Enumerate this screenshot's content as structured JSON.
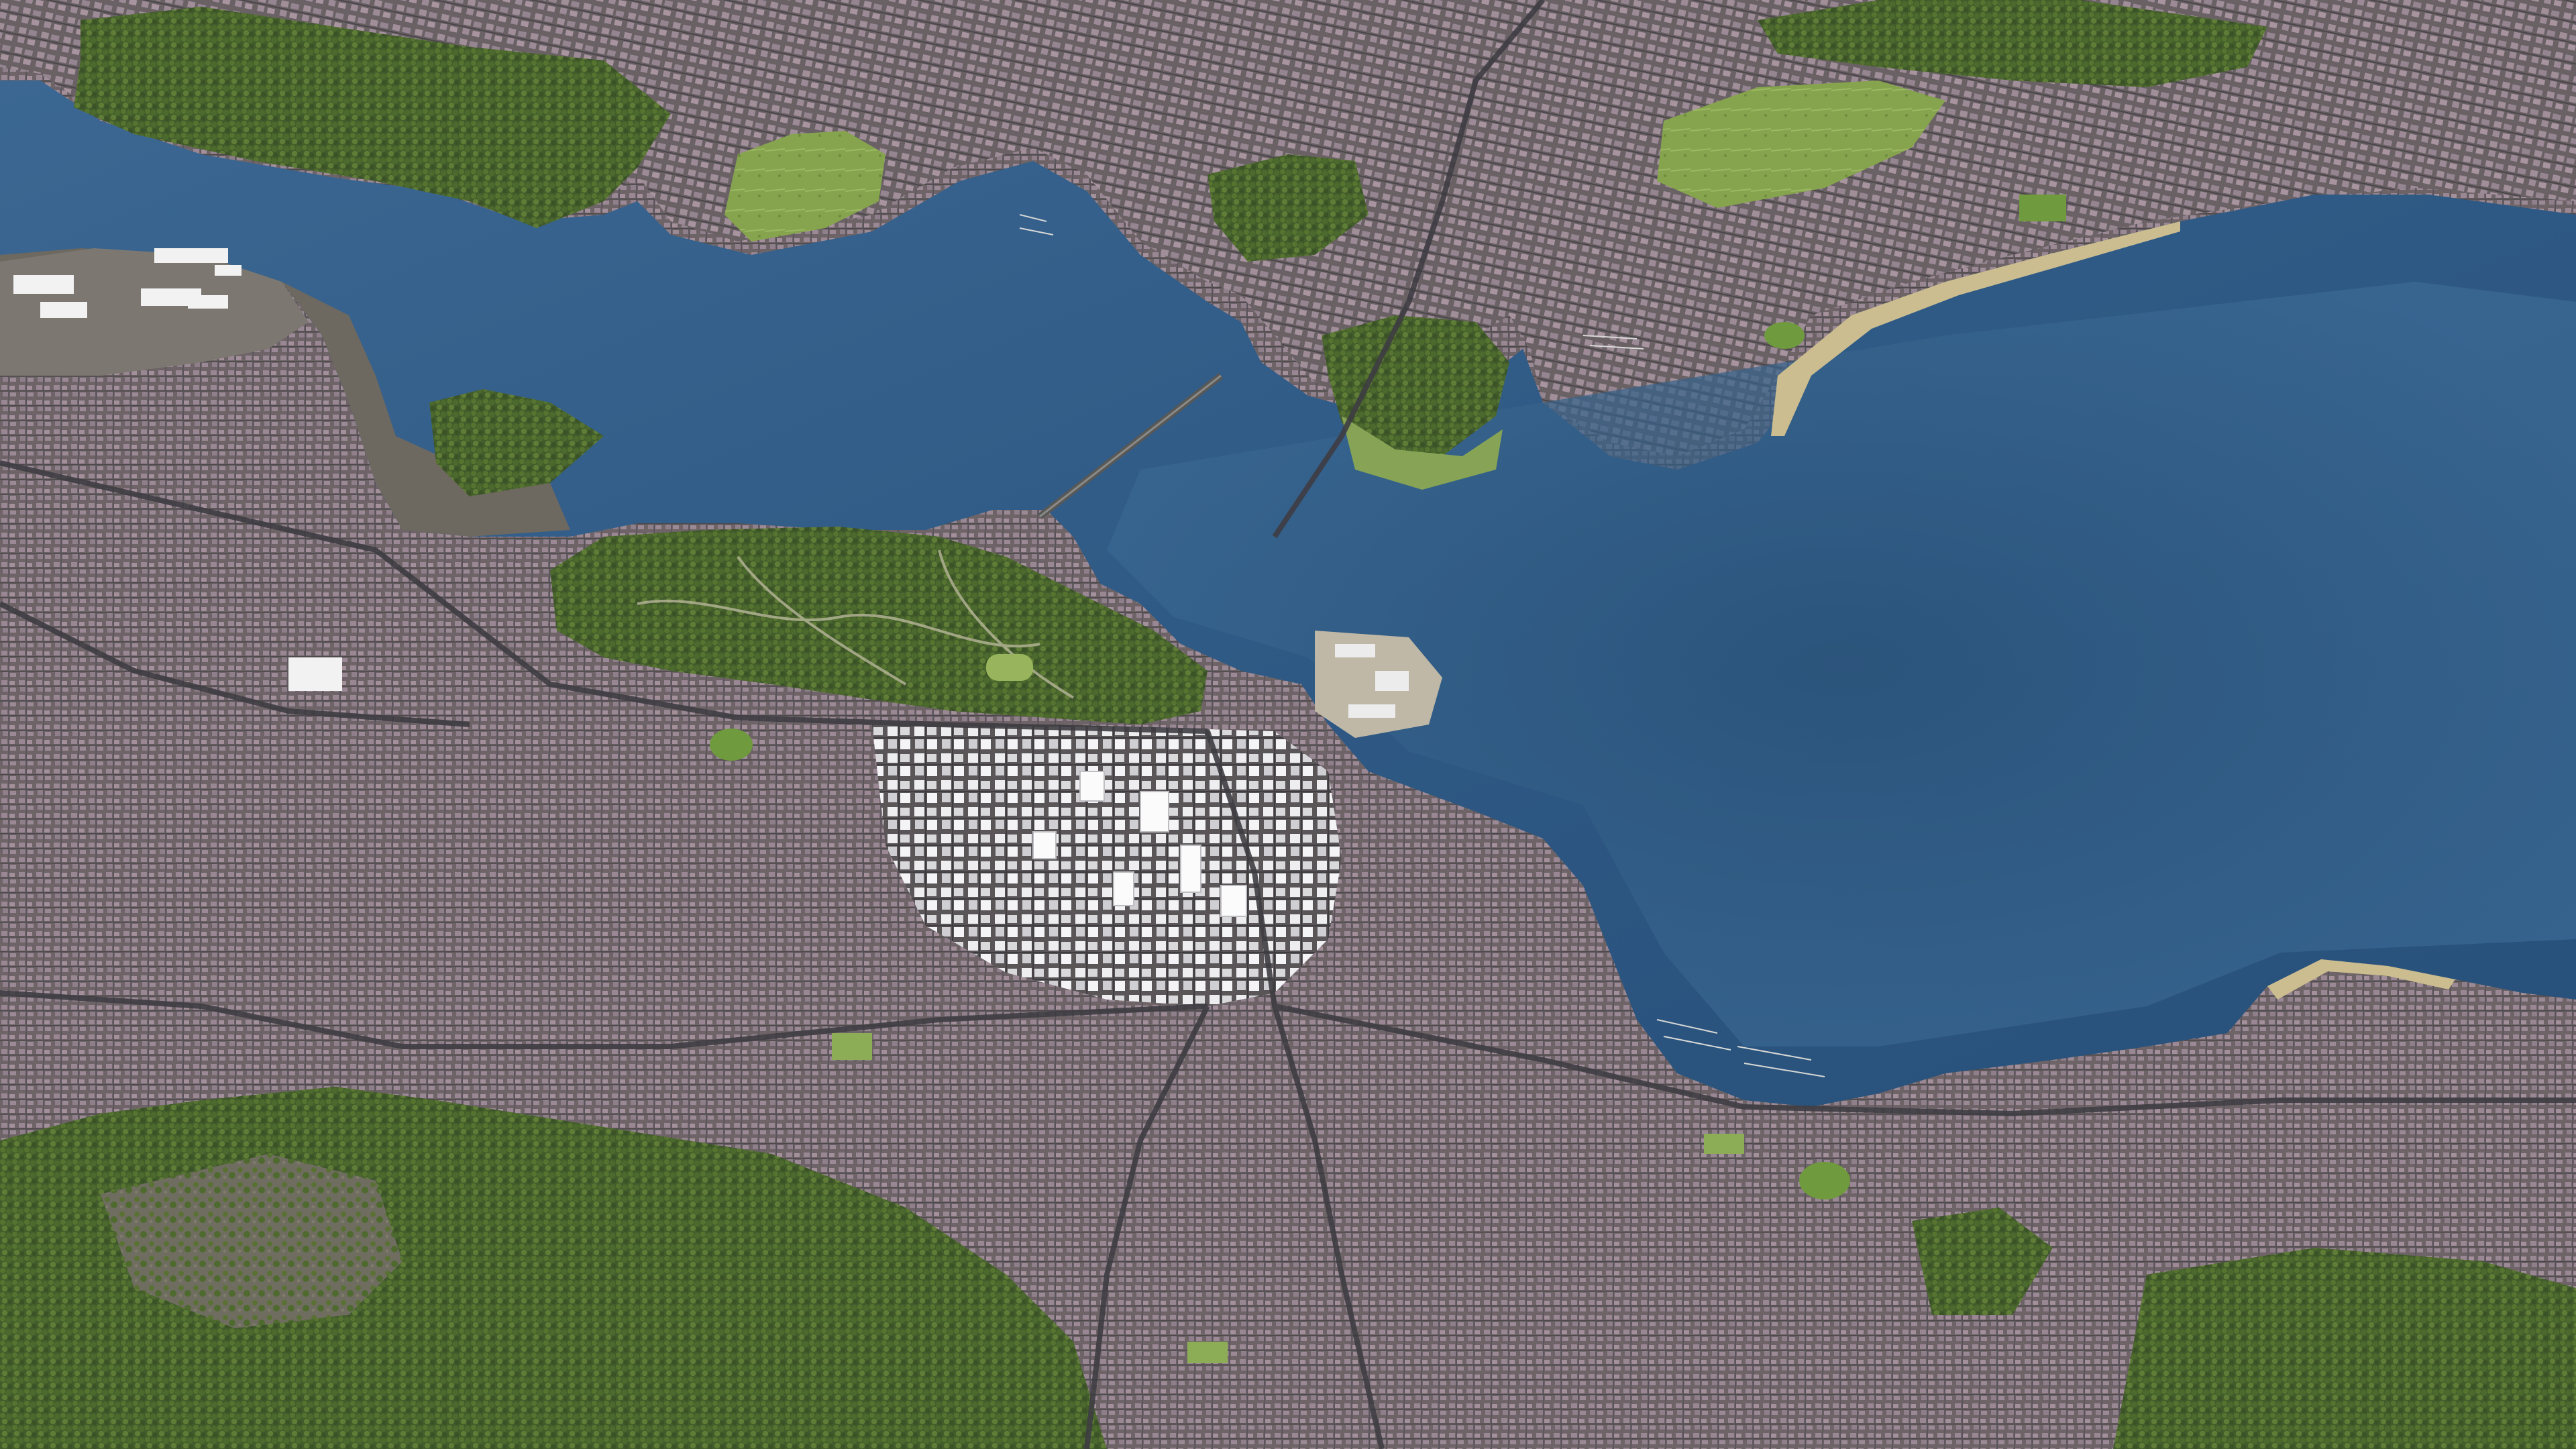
{
  "view": {
    "kind": "aerial-3d-city-render",
    "labels_visible": false
  },
  "palette": {
    "water_deep": "#2d5078",
    "water_mid": "#3d6a96",
    "water_shallow": "#5a86ad",
    "shore_sand": "#c9b98a",
    "urban_roof": "#8e7c86",
    "urban_base": "#6b6466",
    "road": "#4a4a4e",
    "cbd_building": "#e8e8ea",
    "forest_dark": "#3f5a2a",
    "forest_light": "#5f7a3a",
    "grass": "#8fae55",
    "bare_ground": "#7d786f"
  },
  "features": {
    "harbor": "main-harbor",
    "cbd": "central-business-district",
    "bridge": "harbor-bridge",
    "parks": [
      "hill-park",
      "sports-oval",
      "north-shore-park",
      "headland-park"
    ]
  }
}
